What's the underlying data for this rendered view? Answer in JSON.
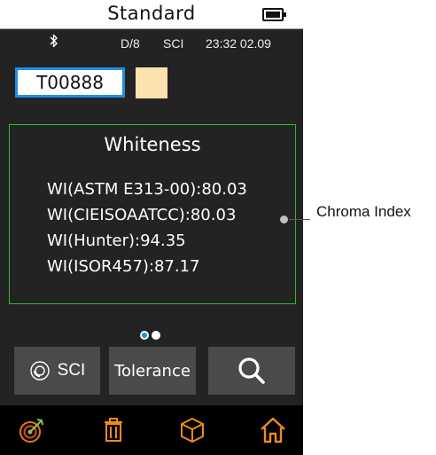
{
  "header": {
    "title": "Standard",
    "battery_icon": "battery-full-icon"
  },
  "status": {
    "bluetooth_icon": "bluetooth-icon",
    "geometry": "D/8",
    "mode": "SCI",
    "time": "23:32 02.09"
  },
  "sample": {
    "id": "T00888",
    "swatch_color": "#fbe2b0"
  },
  "results": {
    "heading": "Whiteness",
    "rows": [
      "WI(ASTM E313-00):80.03",
      "WI(CIEISOAATCC):80.03",
      "WI(Hunter):94.35",
      "WI(ISOR457):87.17"
    ]
  },
  "pager": {
    "count": 2,
    "active": 0
  },
  "actions": {
    "sci_label": "SCI",
    "tolerance_label": "Tolerance",
    "search_icon": "search-icon"
  },
  "nav": {
    "items": [
      "target-icon",
      "trash-icon",
      "box-icon",
      "home-icon"
    ]
  },
  "annotation": {
    "label": "Chroma Index"
  },
  "colors": {
    "accent_blue": "#1e8fe0",
    "panel_border_green": "#2fbd32",
    "nav_orange": "#f08a1c"
  }
}
